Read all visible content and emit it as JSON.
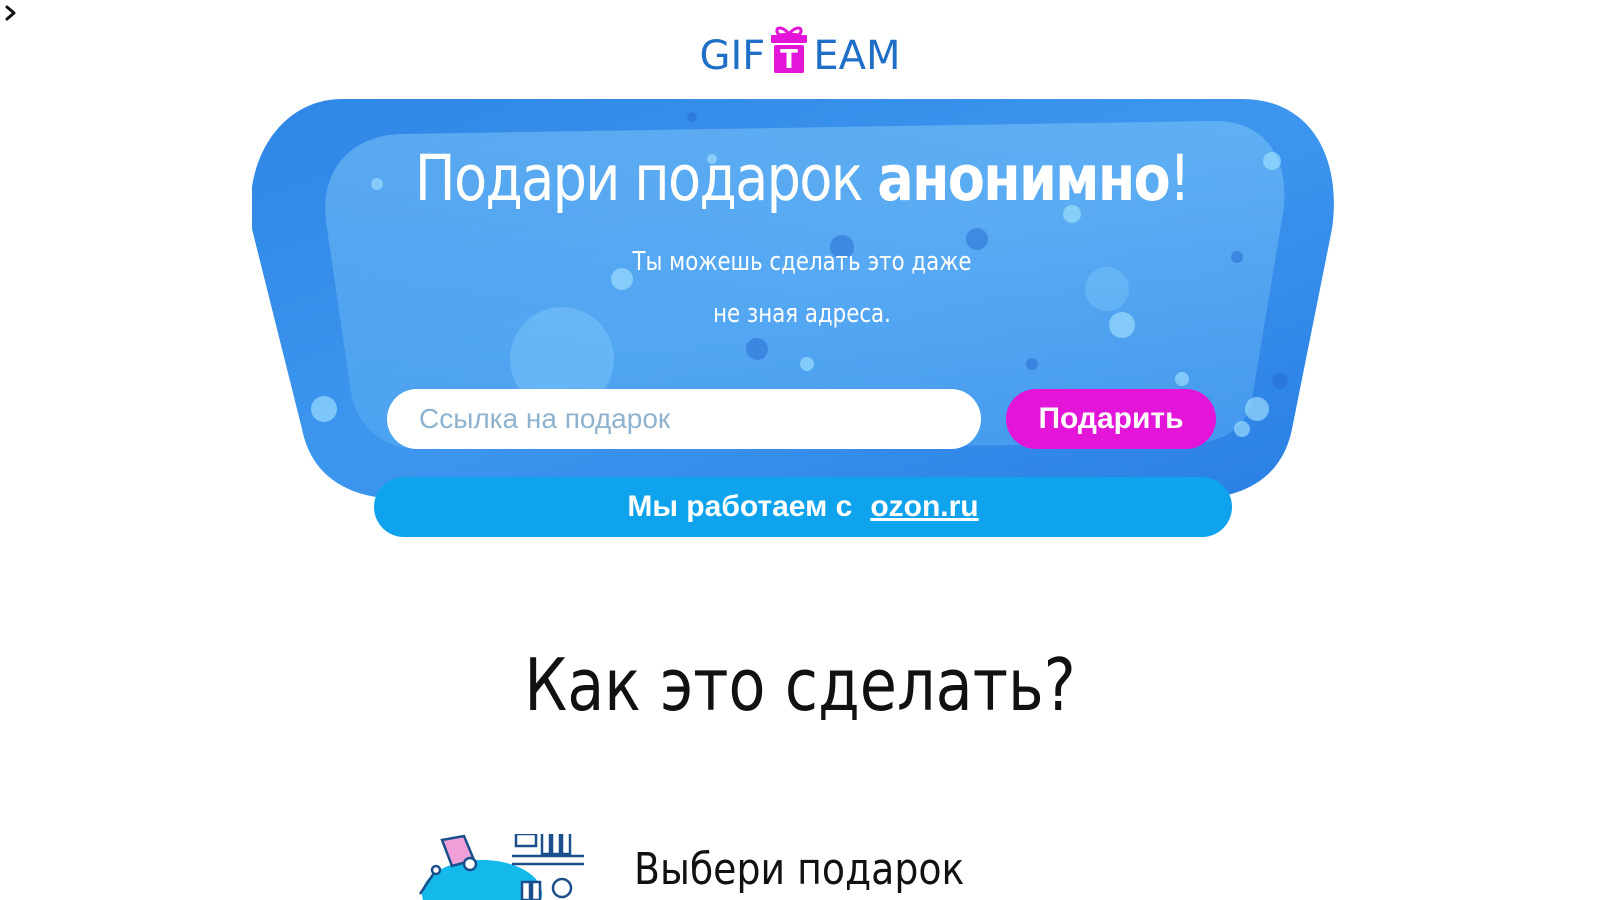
{
  "logo": {
    "left_text": "GIF",
    "center_letter": "T",
    "right_text": "EAM",
    "text_color": "#1f6fc6",
    "gift_color": "#e215d8"
  },
  "hero": {
    "title_regular": "Подари подарок ",
    "title_bold": "анонимно",
    "title_end": "!",
    "subtitle_line1": "Ты можешь сделать это даже",
    "subtitle_line2": "не зная адреса.",
    "input_placeholder": "Ссылка на подарок",
    "input_value": "",
    "button_label": "Подарить",
    "partner_text": "Мы работаем с",
    "partner_link": "ozon.ru",
    "colors": {
      "background": "#3a8ee8",
      "button": "#e215d8",
      "partner_bar": "#0ea3ec"
    }
  },
  "how_to": {
    "title": "Как это сделать?",
    "steps": [
      {
        "title": "Выбери подарок",
        "icon": "desk-lamp-shelf-illustration"
      }
    ]
  },
  "icons": {
    "side_toggle": "chevron-right-icon"
  }
}
